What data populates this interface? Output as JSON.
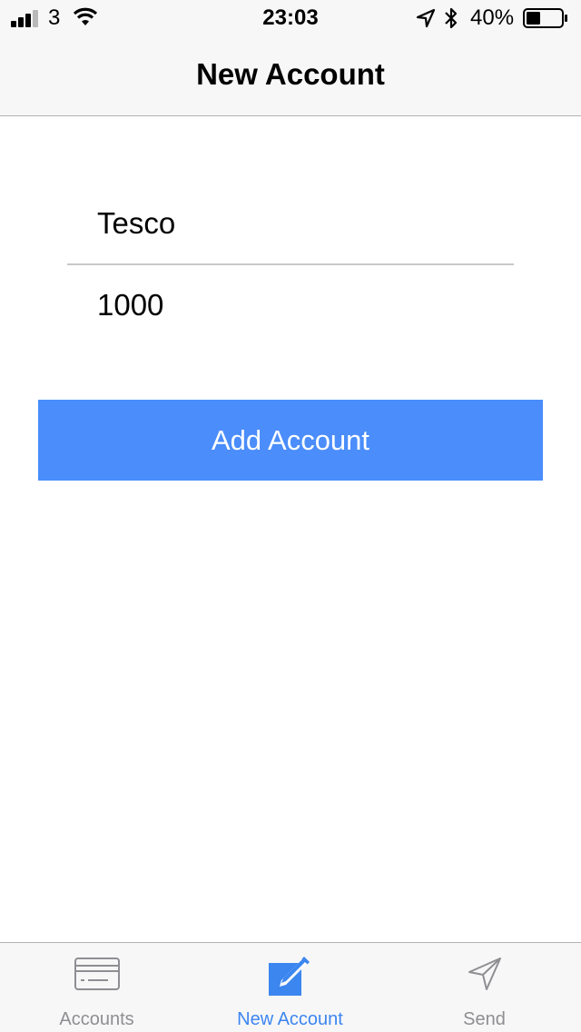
{
  "status_bar": {
    "carrier": "3",
    "time": "23:03",
    "battery_percent": "40%",
    "battery_level": 0.4,
    "signal_bars_filled": 3,
    "signal_bars_total": 4,
    "icons": [
      "signal-icon",
      "wifi-icon",
      "location-arrow-icon",
      "bluetooth-icon",
      "battery-icon"
    ]
  },
  "nav": {
    "title": "New Account"
  },
  "form": {
    "name_value": "Tesco",
    "amount_value": "1000",
    "submit_label": "Add Account"
  },
  "tab_bar": {
    "tabs": [
      {
        "label": "Accounts",
        "icon": "card-icon",
        "selected": false
      },
      {
        "label": "New Account",
        "icon": "compose-icon",
        "selected": true
      },
      {
        "label": "Send",
        "icon": "send-icon",
        "selected": false
      }
    ]
  },
  "colors": {
    "accent": "#4a8dfb",
    "tab_active": "#3c86f0",
    "tab_inactive": "#8e8e93",
    "bar_background": "#f7f7f7",
    "divider": "#c8c8c8"
  }
}
